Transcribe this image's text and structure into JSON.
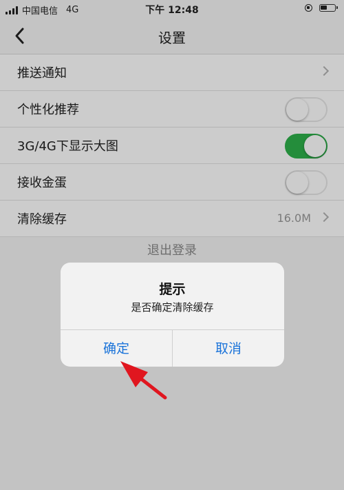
{
  "status_bar": {
    "carrier": "中国电信",
    "network": "4G",
    "time": "下午 12:48"
  },
  "navbar": {
    "title": "设置",
    "back_icon": "chevron-left-icon"
  },
  "settings": {
    "items": [
      {
        "label": "推送通知",
        "type": "link"
      },
      {
        "label": "个性化推荐",
        "type": "toggle",
        "on": false
      },
      {
        "label": "3G/4G下显示大图",
        "type": "toggle",
        "on": true
      },
      {
        "label": "接收金蛋",
        "type": "toggle",
        "on": false
      },
      {
        "label": "清除缓存",
        "type": "link",
        "value": "16.0M"
      }
    ],
    "logout": "退出登录"
  },
  "dialog": {
    "title": "提示",
    "message": "是否确定清除缓存",
    "confirm": "确定",
    "cancel": "取消"
  },
  "colors": {
    "toggle_on": "#2db14a",
    "dialog_button": "#1a73d9",
    "annotation_arrow": "#e0161f"
  }
}
